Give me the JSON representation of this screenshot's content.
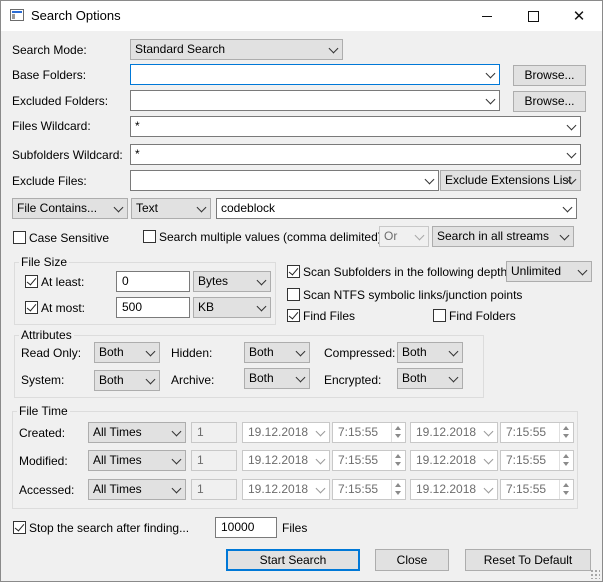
{
  "window": {
    "title": "Search Options"
  },
  "search_mode": {
    "label": "Search Mode:",
    "value": "Standard Search"
  },
  "base_folders": {
    "label": "Base Folders:",
    "value": "",
    "browse": "Browse..."
  },
  "excluded_folders": {
    "label": "Excluded Folders:",
    "value": "",
    "browse": "Browse..."
  },
  "files_wildcard": {
    "label": "Files Wildcard:",
    "value": "*"
  },
  "subfolders_wildcard": {
    "label": "Subfolders Wildcard:",
    "value": "*"
  },
  "exclude_files": {
    "label": "Exclude Files:",
    "value": "",
    "mode": "Exclude Extensions List"
  },
  "content": {
    "type": "File Contains...",
    "format": "Text",
    "value": "codeblock"
  },
  "case_sensitive": {
    "label": "Case Sensitive",
    "checked": false
  },
  "multiple_values": {
    "label": "Search multiple values (comma delimited)",
    "checked": false,
    "operator": "Or",
    "streams": "Search in all streams"
  },
  "file_size": {
    "title": "File Size",
    "at_least": {
      "label": "At least:",
      "checked": true,
      "value": "0",
      "unit": "Bytes"
    },
    "at_most": {
      "label": "At most:",
      "checked": true,
      "value": "500",
      "unit": "KB"
    }
  },
  "scan_subfolders": {
    "label": "Scan Subfolders in the following depth:",
    "checked": true,
    "depth": "Unlimited"
  },
  "scan_ntfs": {
    "label": "Scan NTFS symbolic links/junction points",
    "checked": false
  },
  "find_files": {
    "label": "Find Files",
    "checked": true
  },
  "find_folders": {
    "label": "Find Folders",
    "checked": false
  },
  "attributes": {
    "title": "Attributes",
    "read_only": {
      "label": "Read Only:",
      "value": "Both"
    },
    "hidden": {
      "label": "Hidden:",
      "value": "Both"
    },
    "compressed": {
      "label": "Compressed:",
      "value": "Both"
    },
    "system": {
      "label": "System:",
      "value": "Both"
    },
    "archive": {
      "label": "Archive:",
      "value": "Both"
    },
    "encrypted": {
      "label": "Encrypted:",
      "value": "Both"
    }
  },
  "file_time": {
    "title": "File Time",
    "rows": [
      {
        "label": "Created:",
        "mode": "All Times",
        "count": "1",
        "from_date": "19.12.2018",
        "from_time": "7:15:55",
        "to_date": "19.12.2018",
        "to_time": "7:15:55"
      },
      {
        "label": "Modified:",
        "mode": "All Times",
        "count": "1",
        "from_date": "19.12.2018",
        "from_time": "7:15:55",
        "to_date": "19.12.2018",
        "to_time": "7:15:55"
      },
      {
        "label": "Accessed:",
        "mode": "All Times",
        "count": "1",
        "from_date": "19.12.2018",
        "from_time": "7:15:55",
        "to_date": "19.12.2018",
        "to_time": "7:15:55"
      }
    ]
  },
  "stop_search": {
    "label": "Stop the search after finding...",
    "checked": true,
    "value": "10000",
    "suffix": "Files"
  },
  "buttons": {
    "start": "Start Search",
    "close": "Close",
    "reset": "Reset To Default"
  }
}
